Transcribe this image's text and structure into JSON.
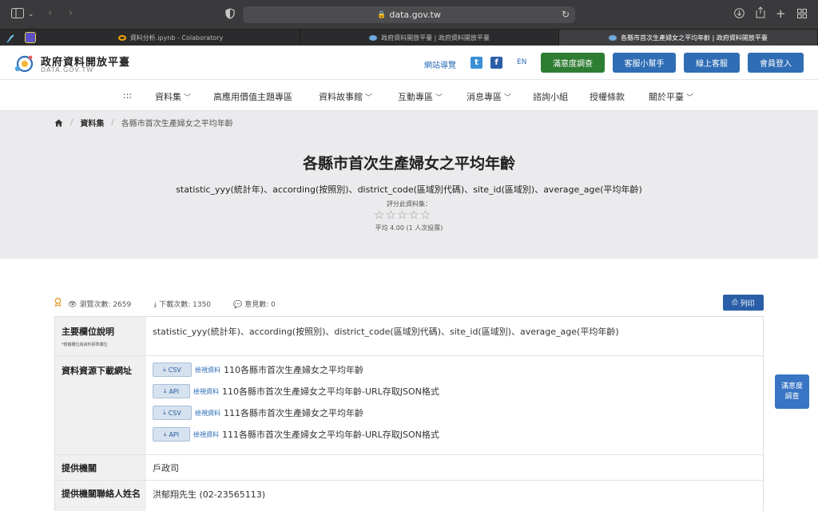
{
  "browser": {
    "url": "data.gov.tw",
    "tabs": [
      {
        "label": "資料分析.ipynb - Colaboratory"
      },
      {
        "label": "政府資料開放平臺 | 政府資料開放平臺"
      },
      {
        "label": "各縣市首次生產婦女之平均年齡 | 政府資料開放平臺"
      }
    ]
  },
  "header": {
    "logo_title": "政府資料開放平臺",
    "logo_sub": "DATA.GOV.TW",
    "sitemap": "網站導覽",
    "twitter": "t",
    "facebook": "f",
    "lang": "EN",
    "buttons": [
      {
        "label": "滿意度調查",
        "color": "#2e7d32"
      },
      {
        "label": "客服小幫手",
        "color": "#2f6db5"
      },
      {
        "label": "線上客服",
        "color": "#2f6db5"
      },
      {
        "label": "會員登入",
        "color": "#2f6db5"
      }
    ]
  },
  "nav": {
    "items": [
      {
        "label": ":::"
      },
      {
        "label": "資料集"
      },
      {
        "label": "高應用價值主題專區"
      },
      {
        "label": "資料故事館"
      },
      {
        "label": "互動專區"
      },
      {
        "label": "消息專區"
      },
      {
        "label": "諮詢小組"
      },
      {
        "label": "授權條款"
      },
      {
        "label": "關於平臺"
      }
    ]
  },
  "breadcrumb": {
    "category": "資料集",
    "current": "各縣市首次生產婦女之平均年齡"
  },
  "hero": {
    "title": "各縣市首次生產婦女之平均年齡",
    "description": "statistic_yyy(統計年)、according(按照別)、district_code(區域別代碼)、site_id(區域別)、average_age(平均年齡)",
    "rate_label": "評分此資料集：",
    "stars": "☆☆☆☆☆",
    "average": "平均 4.00 (1 人次投票)"
  },
  "stats": {
    "views": "瀏覽次數: 2659",
    "downloads": "下載次數: 1350",
    "comments": "意見數: 0",
    "print": "列印"
  },
  "table": {
    "fields_label": "主要欄位說明",
    "fields_note": "*粗體欄位為資料標準欄位",
    "fields_value": "statistic_yyy(統計年)、according(按照別)、district_code(區域別代碼)、site_id(區域別)、average_age(平均年齡)",
    "resources_label": "資料資源下載網址",
    "resources": [
      {
        "format": "CSV",
        "view": "檢視資料",
        "name": "110各縣市首次生產婦女之平均年齡"
      },
      {
        "format": "API",
        "view": "檢視資料",
        "name": "110各縣市首次生產婦女之平均年齡-URL存取JSON格式"
      },
      {
        "format": "CSV",
        "view": "檢視資料",
        "name": "111各縣市首次生產婦女之平均年齡"
      },
      {
        "format": "API",
        "view": "檢視資料",
        "name": "111各縣市首次生產婦女之平均年齡-URL存取JSON格式"
      }
    ],
    "agency_label": "提供機關",
    "agency_value": "戶政司",
    "contact_label": "提供機關聯絡人姓名",
    "contact_value": "洪郁翔先生 (02-23565113)"
  },
  "float_button": "滿意度調查"
}
